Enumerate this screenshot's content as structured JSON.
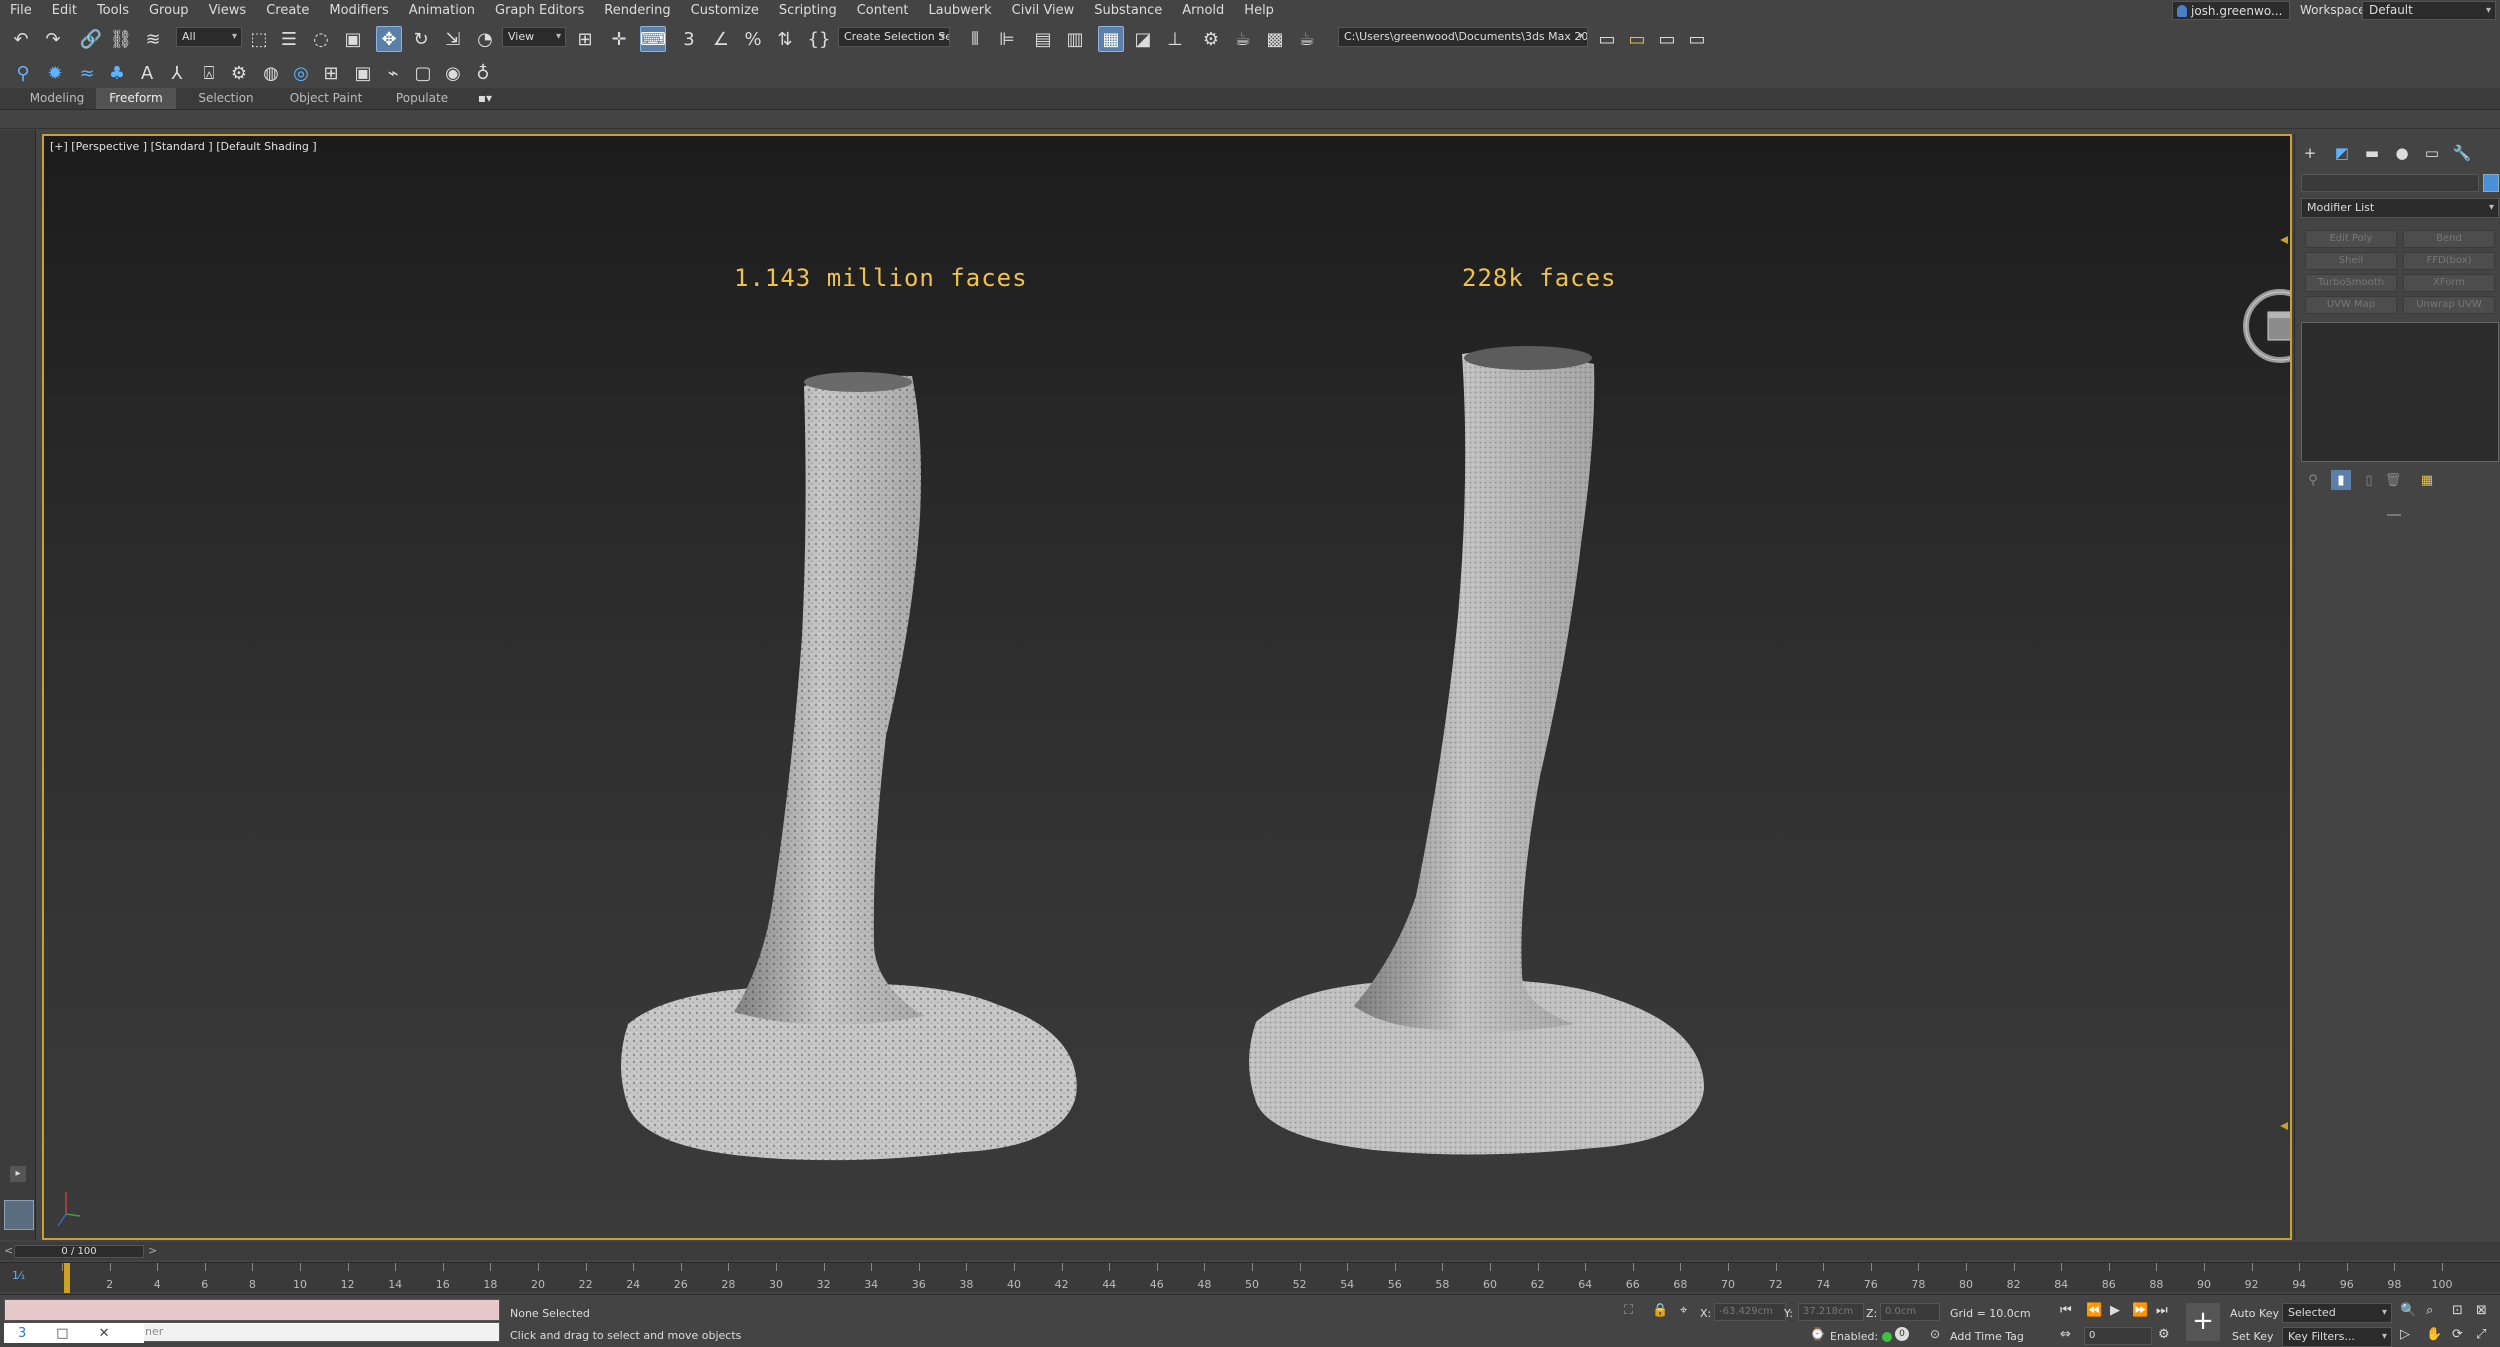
{
  "menu": [
    "File",
    "Edit",
    "Tools",
    "Group",
    "Views",
    "Create",
    "Modifiers",
    "Animation",
    "Graph Editors",
    "Rendering",
    "Customize",
    "Scripting",
    "Content",
    "Laubwerk",
    "Civil View",
    "Substance",
    "Arnold",
    "Help"
  ],
  "account": {
    "user": "josh.greenwo...",
    "workspaces_label": "Workspaces:",
    "workspace": "Default"
  },
  "toolbar": {
    "selection_filter": "All",
    "ref_coord": "View",
    "selection_set": "Create Selection Se",
    "project_path": "C:\\Users\\greenwood\\Documents\\3ds Max 2022"
  },
  "ribbon": {
    "tabs": [
      "Modeling",
      "Freeform",
      "Selection",
      "Object Paint",
      "Populate"
    ],
    "active": "Freeform"
  },
  "viewport": {
    "label": "[+] [Perspective ] [Standard ] [Default Shading ]",
    "caption_left": "1.143 million faces",
    "caption_right": "228k faces"
  },
  "command_panel": {
    "modifier_list": "Modifier List",
    "modifier_buttons": [
      "Edit Poly",
      "Bend",
      "Shell",
      "FFD(box)",
      "TurboSmooth",
      "XForm",
      "UVW Map",
      "Unwrap UVW"
    ]
  },
  "timeline": {
    "frame_display": "0 / 100",
    "ticks": [
      0,
      2,
      4,
      6,
      8,
      10,
      12,
      14,
      16,
      18,
      20,
      22,
      24,
      26,
      28,
      30,
      32,
      34,
      36,
      38,
      40,
      42,
      44,
      46,
      48,
      50,
      52,
      54,
      56,
      58,
      60,
      62,
      64,
      66,
      68,
      70,
      72,
      74,
      76,
      78,
      80,
      82,
      84,
      86,
      88,
      90,
      92,
      94,
      96,
      98,
      100
    ]
  },
  "status": {
    "selection": "None Selected",
    "prompt": "Click and drag to select and move objects",
    "x_label": "X:",
    "x_value": "-63.429cm",
    "y_label": "Y:",
    "y_value": "37.218cm",
    "z_label": "Z:",
    "z_value": "0.0cm",
    "grid": "Grid = 10.0cm",
    "enabled": "Enabled:",
    "add_time_tag": "Add Time Tag",
    "auto_key": "Auto Key",
    "set_key": "Set Key",
    "key_mode": "Selected",
    "key_filters": "Key Filters...",
    "current_frame": "0",
    "script_hint": "ner"
  }
}
